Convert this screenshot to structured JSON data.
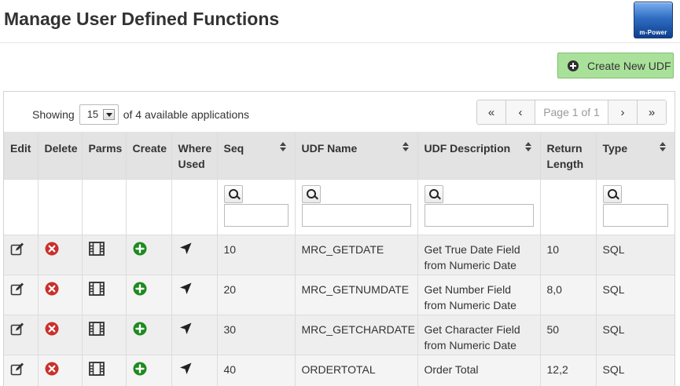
{
  "page": {
    "title": "Manage User Defined Functions",
    "logo_text": "m-Power",
    "create_button_label": "Create New UDF"
  },
  "pagination": {
    "showing_label": "Showing",
    "page_size": "15",
    "available_label": "of 4 available applications",
    "page_info": "Page 1 of 1",
    "first_glyph": "«",
    "prev_glyph": "‹",
    "next_glyph": "›",
    "last_glyph": "»"
  },
  "table": {
    "columns": [
      {
        "label": "Edit",
        "sortable": false
      },
      {
        "label": "Delete",
        "sortable": false
      },
      {
        "label": "Parms",
        "sortable": false
      },
      {
        "label": "Create",
        "sortable": false
      },
      {
        "label": "Where Used",
        "sortable": false
      },
      {
        "label": "Seq",
        "sortable": true
      },
      {
        "label": "UDF Name",
        "sortable": true
      },
      {
        "label": "UDF Description",
        "sortable": true
      },
      {
        "label": "Return Length",
        "sortable": false
      },
      {
        "label": "Type",
        "sortable": true
      }
    ],
    "filters": [
      "Seq",
      "UDF Name",
      "UDF Description",
      "Type"
    ],
    "rows": [
      {
        "seq": "10",
        "name": "MRC_GETDATE",
        "description": "Get True Date Field from Numeric Date",
        "return_length": "10",
        "type": "SQL"
      },
      {
        "seq": "20",
        "name": "MRC_GETNUMDATE",
        "description": "Get Number Field from Numeric Date",
        "return_length": "8,0",
        "type": "SQL"
      },
      {
        "seq": "30",
        "name": "MRC_GETCHARDATE",
        "description": "Get Character Field from Numeric Date",
        "return_length": "50",
        "type": "SQL"
      },
      {
        "seq": "40",
        "name": "ORDERTOTAL",
        "description": "Order Total",
        "return_length": "12,2",
        "type": "SQL"
      }
    ],
    "row_icons": [
      "edit-icon",
      "delete-icon",
      "film-icon",
      "add-icon",
      "where-used-arrow-icon"
    ]
  },
  "colors": {
    "create_button_bg": "#a9e19a",
    "delete_icon": "#c9302c",
    "add_icon": "#1f8a1f",
    "header_bg": "#e3e3e3"
  }
}
